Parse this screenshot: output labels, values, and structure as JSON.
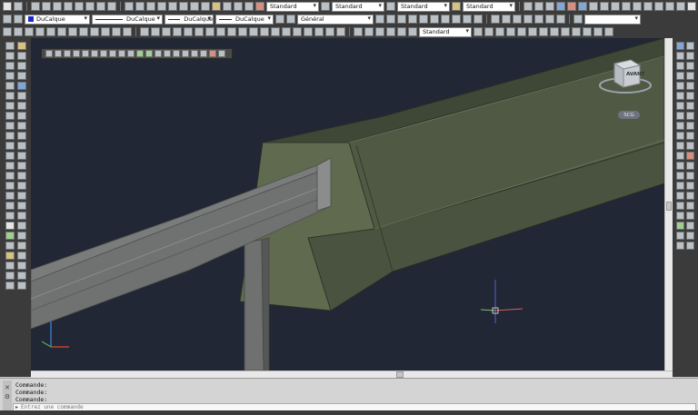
{
  "toolbar": {
    "textstyle": "Standard",
    "dimstyle": "Standard",
    "tablestyle": "Standard",
    "mleaderstyle": "Standard",
    "color": "DuCalque",
    "linetype": "DuCalque",
    "lineweight": "DuCalque",
    "plotstyle": "DuCalque",
    "layer_state": "Général",
    "visualstyle": "Standard"
  },
  "viewport": {
    "viewcube_face": "AVANT",
    "wcs_label": "SCG"
  },
  "command": {
    "history": [
      "Commande:",
      "Commande:",
      "Commande:"
    ],
    "placeholder": "Entrez une commande"
  },
  "colors": {
    "viewport_bg": "#212734",
    "ui_dark": "#3b3b3b",
    "concrete": "#4b5443",
    "rail": "#6f7070",
    "layer_color": "#1a2cc8"
  },
  "icons": [
    "new-file-icon",
    "open-icon",
    "save-icon",
    "print-icon",
    "undo-icon",
    "redo-icon",
    "layer-icon",
    "line-icon",
    "circle-icon",
    "arc-icon",
    "hatch-icon",
    "move-icon",
    "copy-icon",
    "rotate-icon",
    "orbit-icon",
    "zoom-icon",
    "pan-icon",
    "help-icon"
  ]
}
